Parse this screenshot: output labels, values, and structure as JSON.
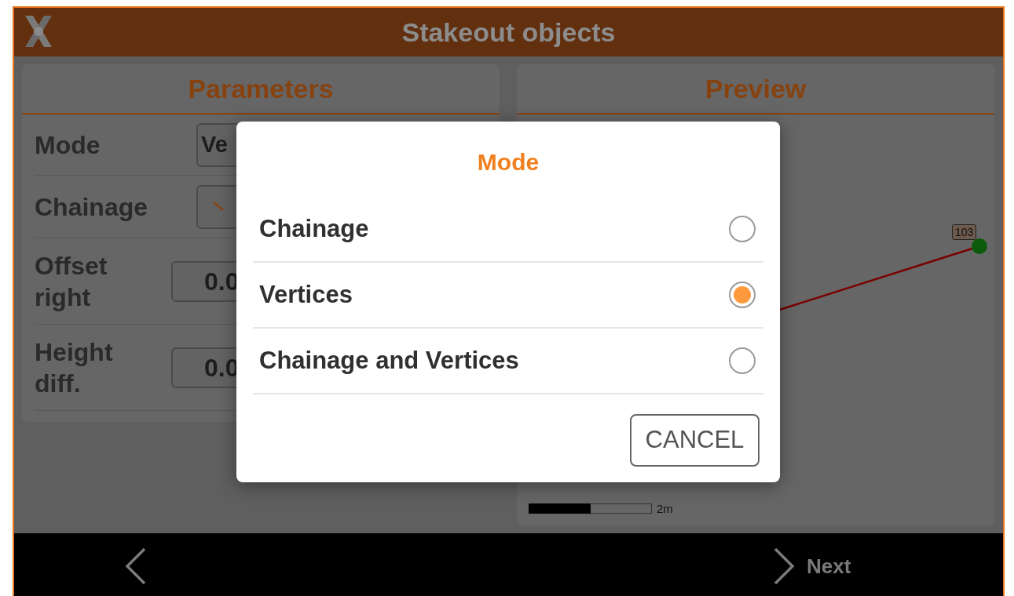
{
  "app_bar": {
    "title": "Stakeout objects"
  },
  "parameters": {
    "title": "Parameters",
    "rows": [
      {
        "label": "Mode",
        "kind": "select",
        "value": "Ve"
      },
      {
        "label": "Chainage",
        "kind": "toggle"
      },
      {
        "label": "Offset right",
        "kind": "number",
        "value": "0.0"
      },
      {
        "label": "Height diff.",
        "kind": "number",
        "value": "0.0"
      }
    ]
  },
  "preview": {
    "title": "Preview",
    "point_label": "103",
    "scale_label": "2m"
  },
  "dialog": {
    "title": "Mode",
    "options": [
      {
        "label": "Chainage",
        "selected": false
      },
      {
        "label": "Vertices",
        "selected": true
      },
      {
        "label": "Chainage and Vertices",
        "selected": false
      }
    ],
    "cancel": "CANCEL"
  },
  "bottom_bar": {
    "next": "Next"
  }
}
